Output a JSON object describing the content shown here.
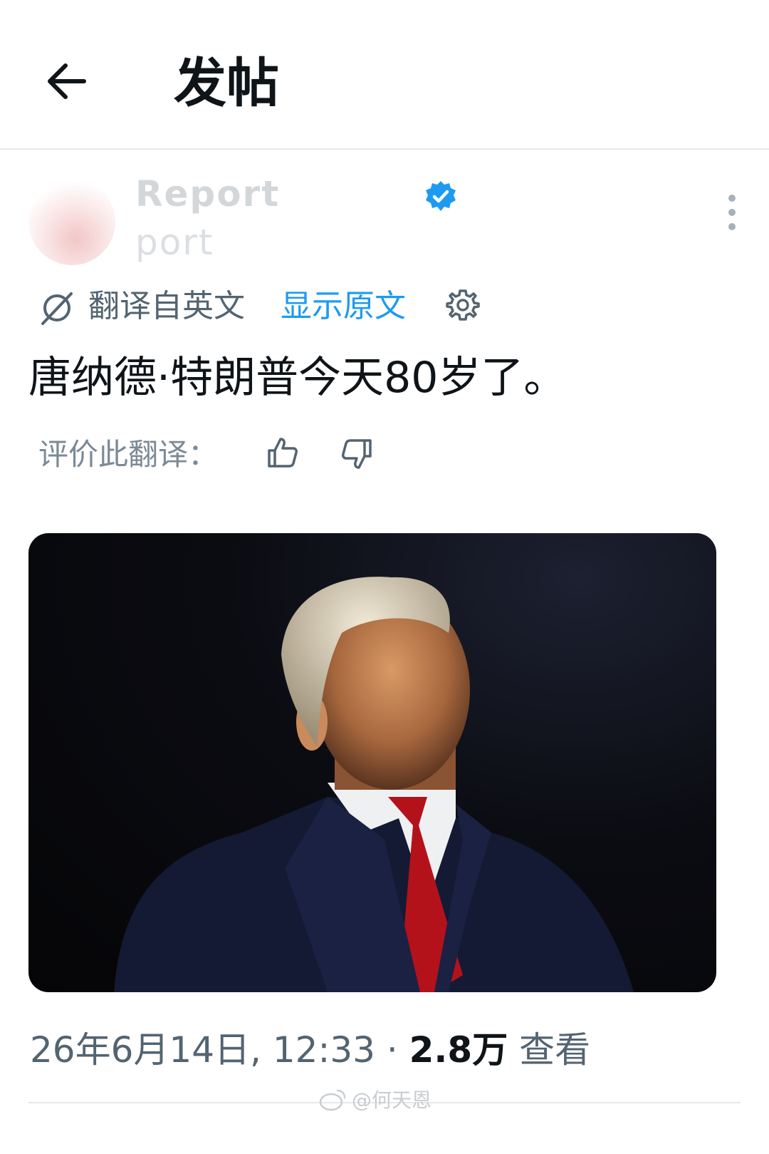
{
  "header": {
    "title": "发帖",
    "back_icon": "arrow-left-icon"
  },
  "author": {
    "display_name": "Report",
    "handle": "port",
    "verified_color": "#1d9bf0"
  },
  "translation": {
    "translated_label": "翻译自英文",
    "show_original_label": "显示原文",
    "link_color": "#1d9bf0"
  },
  "post": {
    "text": "唐纳德·特朗普今天80岁了。"
  },
  "rating": {
    "label": "评价此翻译："
  },
  "meta": {
    "timestamp": "26年6月14日, 12:33",
    "separator": " · ",
    "views_count": "2.8万",
    "views_label": " 查看"
  },
  "watermark": {
    "text": "@何天恩"
  }
}
